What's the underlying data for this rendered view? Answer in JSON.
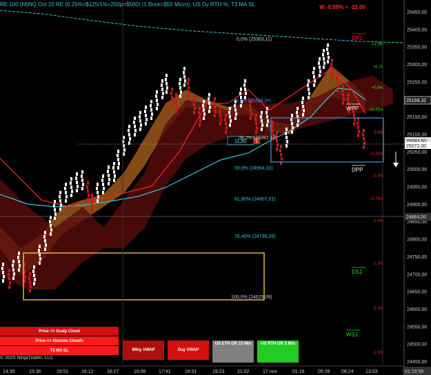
{
  "header": {
    "title": "RE 100 (M)NQ Oct 20 RE (0.25%=$125/1%=250p=$500)  (1 Brick=$50 Micro), US Dy RTH %, T3 MA SL",
    "pnl": "W -0.09% = -22.00"
  },
  "price_axis": {
    "labels": [
      "25450,00",
      "25400,00",
      "25350,00",
      "25300,00",
      "25250,00",
      "25200,00",
      "25150,00",
      "25100,00",
      "25050,00",
      "25000,00",
      "24950,00",
      "24900,00",
      "24850,00",
      "24800,00",
      "24750,00",
      "24700,00",
      "24650,00",
      "24600,00",
      "24550,00",
      "24500,00",
      "24450,00"
    ],
    "current_price": "25199,32",
    "marker_price": "25072,00",
    "marker_price2": "25083,50",
    "crosshair_price": "24864,00"
  },
  "pct_labels": [
    "+1.0%",
    "+0.75",
    "+0.5%",
    "+0.25%",
    "0.0%",
    "-0.25%",
    "-0.5%",
    "-0.75%",
    "-1.0%",
    "-1.5%",
    "-2.0%",
    "-2.5%"
  ],
  "fib_labels": [
    "0,0% (25363,11)",
    "23,6% (25188,94)",
    "38,2% (25081,19)",
    "50,0% (24994,10)",
    "61,80% (24907,01)",
    "76,40% (24799,26)",
    "100,0% (24625,09)"
  ],
  "pivots": [
    "DR1",
    "WPP",
    "DPP",
    "DS1",
    "WS1"
  ],
  "time_axis": [
    "14:35",
    "15:36",
    "15:51",
    "16:12",
    "16:27",
    "16:56",
    "17:41",
    "18:51",
    "19:23",
    "21:02",
    "17 nov",
    "01:16",
    "05:26",
    "08:24",
    "13:03"
  ],
  "time_clock": "01:19:56",
  "trade_box": {
    "qty": "11,50",
    "badge": "1"
  },
  "buttons": {
    "scalp_cloud": "Price <> Scalp Cloud",
    "outside_clouds": "Price <> Outside Clouds",
    "t3_ma_sl": "T3 MA SL",
    "wkly_vwap": "Wkly VWAP",
    "day_vwap": "Day VWAP",
    "us_eth": "US ETH OR 15 Min",
    "us_rth": "US RTH OR 5 Min"
  },
  "copyright": "© 2025 NinjaTrader, LLC",
  "colors": {
    "bg": "#000000",
    "up_brick": "#ffffff",
    "down_brick": "#c81a1a",
    "cloud": "#b0641e",
    "cyan": "#35c8d8",
    "red": "#ff2020",
    "yellow": "#ffd740",
    "blue": "#3a8fe6",
    "green_btn": "#22cc22",
    "grey_btn": "#808080"
  }
}
